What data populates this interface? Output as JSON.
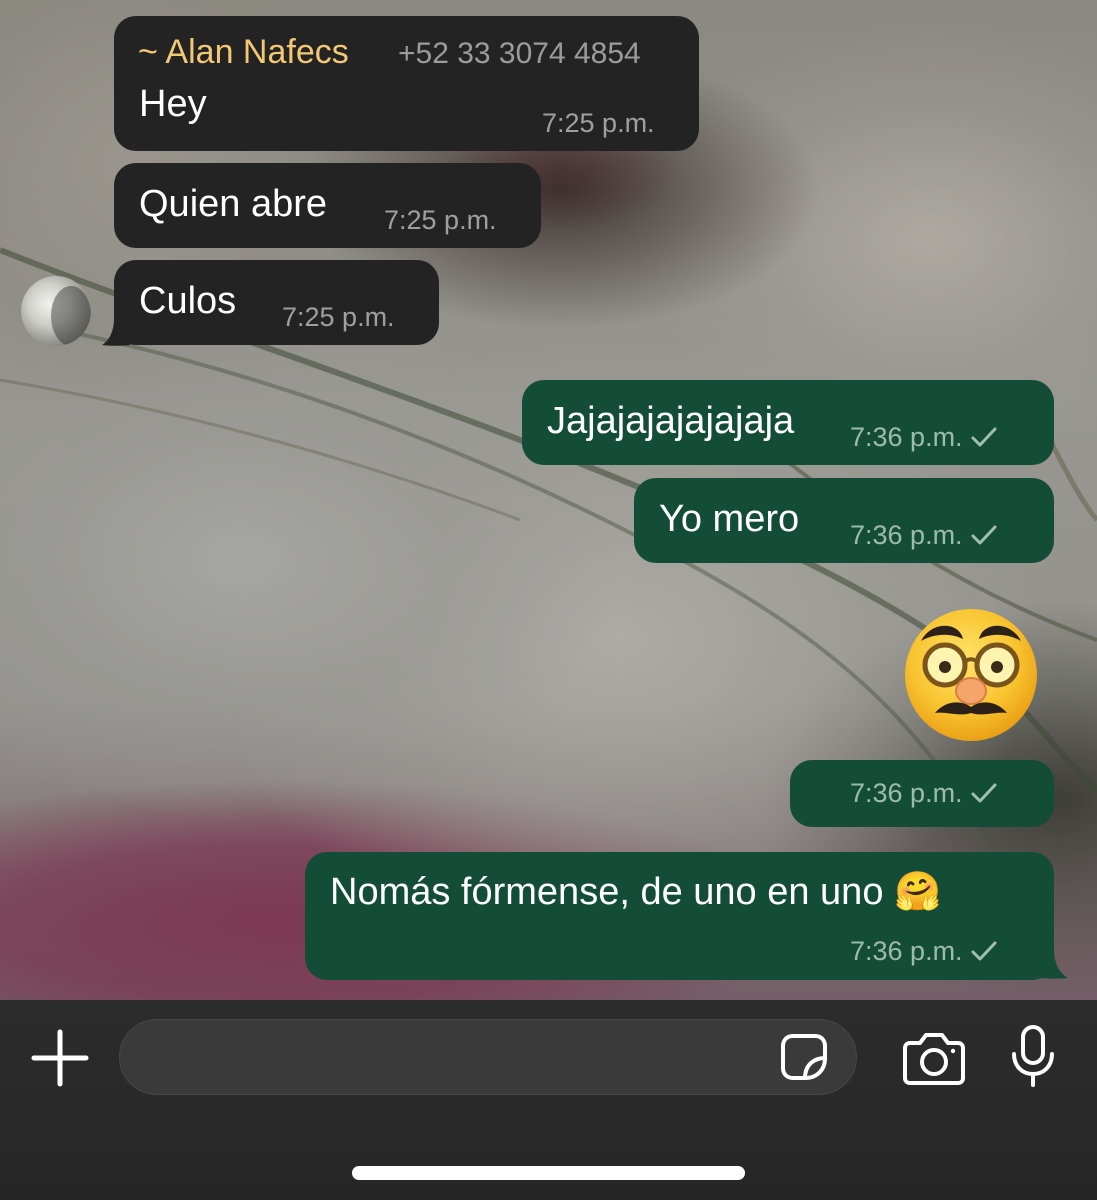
{
  "messages": [
    {
      "direction": "incoming",
      "sender_name": "~ Alan Nafecs",
      "sender_phone": "+52 33 3074 4854",
      "text": "Hey",
      "time": "7:25 p.m."
    },
    {
      "direction": "incoming",
      "text": "Quien abre",
      "time": "7:25 p.m."
    },
    {
      "direction": "incoming",
      "text": "Culos",
      "time": "7:25 p.m.",
      "avatar_icon": "contact-avatar"
    },
    {
      "direction": "outgoing",
      "text": "Jajajajajajajaja",
      "time": "7:36 p.m.",
      "status": "sent-check-icon"
    },
    {
      "direction": "outgoing",
      "text": "Yo mero",
      "time": "7:36 p.m.",
      "status": "sent-check-icon"
    },
    {
      "direction": "outgoing",
      "sticker": "disguised-face-emoji",
      "time": "7:36 p.m.",
      "status": "sent-check-icon"
    },
    {
      "direction": "outgoing",
      "text": "Nomás fórmense, de uno en uno 🤗",
      "time": "7:36 p.m.",
      "status": "sent-check-icon"
    }
  ],
  "input_bar": {
    "message_value": "",
    "icons": [
      "plus-icon",
      "sticker-icon",
      "camera-icon",
      "microphone-icon"
    ]
  },
  "colors": {
    "incoming_bubble": "#232323",
    "outgoing_bubble": "#134d37",
    "sender_name": "#f2c874",
    "input_bar": "#2a2a2a"
  }
}
